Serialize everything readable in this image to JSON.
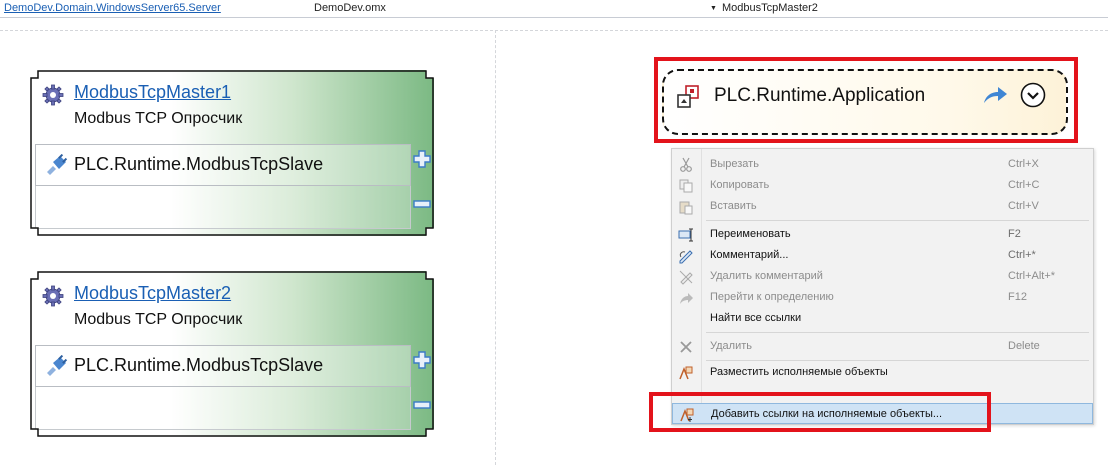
{
  "topbar": {
    "server_link": "DemoDev.Domain.WindowsServer65.Server",
    "file": "DemoDev.omx",
    "object": "ModbusTcpMaster2"
  },
  "blocks": [
    {
      "title": "ModbusTcpMaster1",
      "subtitle": "Modbus TCP Опросчик",
      "slave": "PLC.Runtime.ModbusTcpSlave",
      "icon": "gear-icon"
    },
    {
      "title": "ModbusTcpMaster2",
      "subtitle": "Modbus TCP Опросчик",
      "slave": "PLC.Runtime.ModbusTcpSlave",
      "icon": "gear-icon"
    }
  ],
  "app_block": {
    "label": "PLC.Runtime.Application",
    "icon": "application-icon"
  },
  "context_menu": {
    "items": [
      {
        "label": "Вырезать",
        "shortcut": "Ctrl+X",
        "icon": "scissors-icon",
        "disabled": true
      },
      {
        "label": "Копировать",
        "shortcut": "Ctrl+C",
        "icon": "copy-icon",
        "disabled": true
      },
      {
        "label": "Вставить",
        "shortcut": "Ctrl+V",
        "icon": "paste-icon",
        "disabled": true
      },
      {
        "label": "Переименовать",
        "shortcut": "F2",
        "icon": "rename-icon",
        "disabled": false
      },
      {
        "label": "Комментарий...",
        "shortcut": "Ctrl+*",
        "icon": "comment-icon",
        "disabled": false
      },
      {
        "label": "Удалить комментарий",
        "shortcut": "Ctrl+Alt+*",
        "icon": "uncomment-icon",
        "disabled": true
      },
      {
        "label": "Перейти к определению",
        "shortcut": "F12",
        "icon": "goto-icon",
        "disabled": true
      },
      {
        "label": "Найти все ссылки",
        "shortcut": "",
        "icon": "",
        "disabled": false
      },
      {
        "label": "Удалить",
        "shortcut": "Delete",
        "icon": "delete-icon",
        "disabled": true
      },
      {
        "label": "Разместить исполняемые объекты",
        "shortcut": "",
        "icon": "place-objects-icon",
        "disabled": false
      },
      {
        "label": "Добавить ссылки на исполняемые объекты...",
        "shortcut": "",
        "icon": "add-links-icon",
        "disabled": false
      }
    ]
  },
  "colors": {
    "link": "#1a5fb4",
    "highlight_red": "#e3131b",
    "block_green": "#7bb983",
    "menu_hover": "#cfe3f5"
  }
}
